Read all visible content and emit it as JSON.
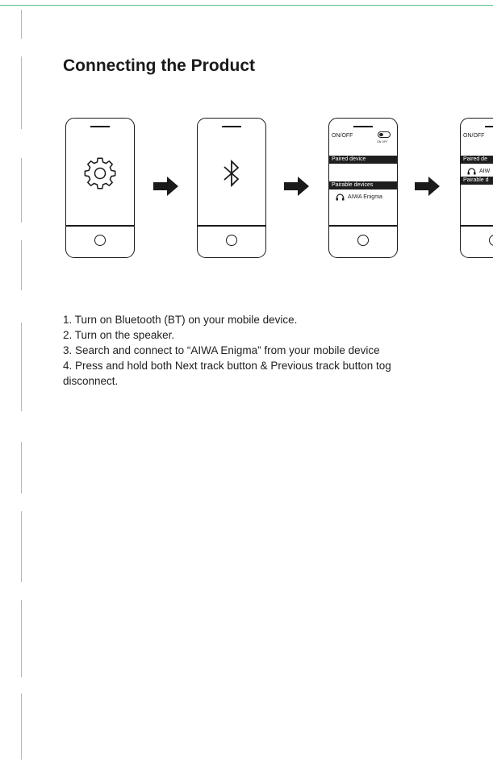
{
  "document": {
    "title": "Connecting the Product"
  },
  "phone_screens": {
    "onoff_label": "ON/OFF",
    "toggle_text": "ON   OFF",
    "paired_header": "Paired device",
    "pairable_header": "Pairable devices",
    "device_name": "AIWA Enigma",
    "partial_paired_header": "Paired de",
    "partial_pairable_header": "Pairable d",
    "partial_device_name": "AIW"
  },
  "icons": [
    "gear-icon",
    "bluetooth-icon",
    "headphones-icon",
    "arrow-right-icon"
  ],
  "instructions": {
    "step1": "1. Turn on Bluetooth (BT) on your mobile device.",
    "step2": "2. Turn on the speaker.",
    "step3": "3. Search and connect to “AIWA Enigma” from your mobile device",
    "step4_line1": "4. Press and hold both Next track button & Previous track button tog",
    "step4_line2": "disconnect."
  }
}
